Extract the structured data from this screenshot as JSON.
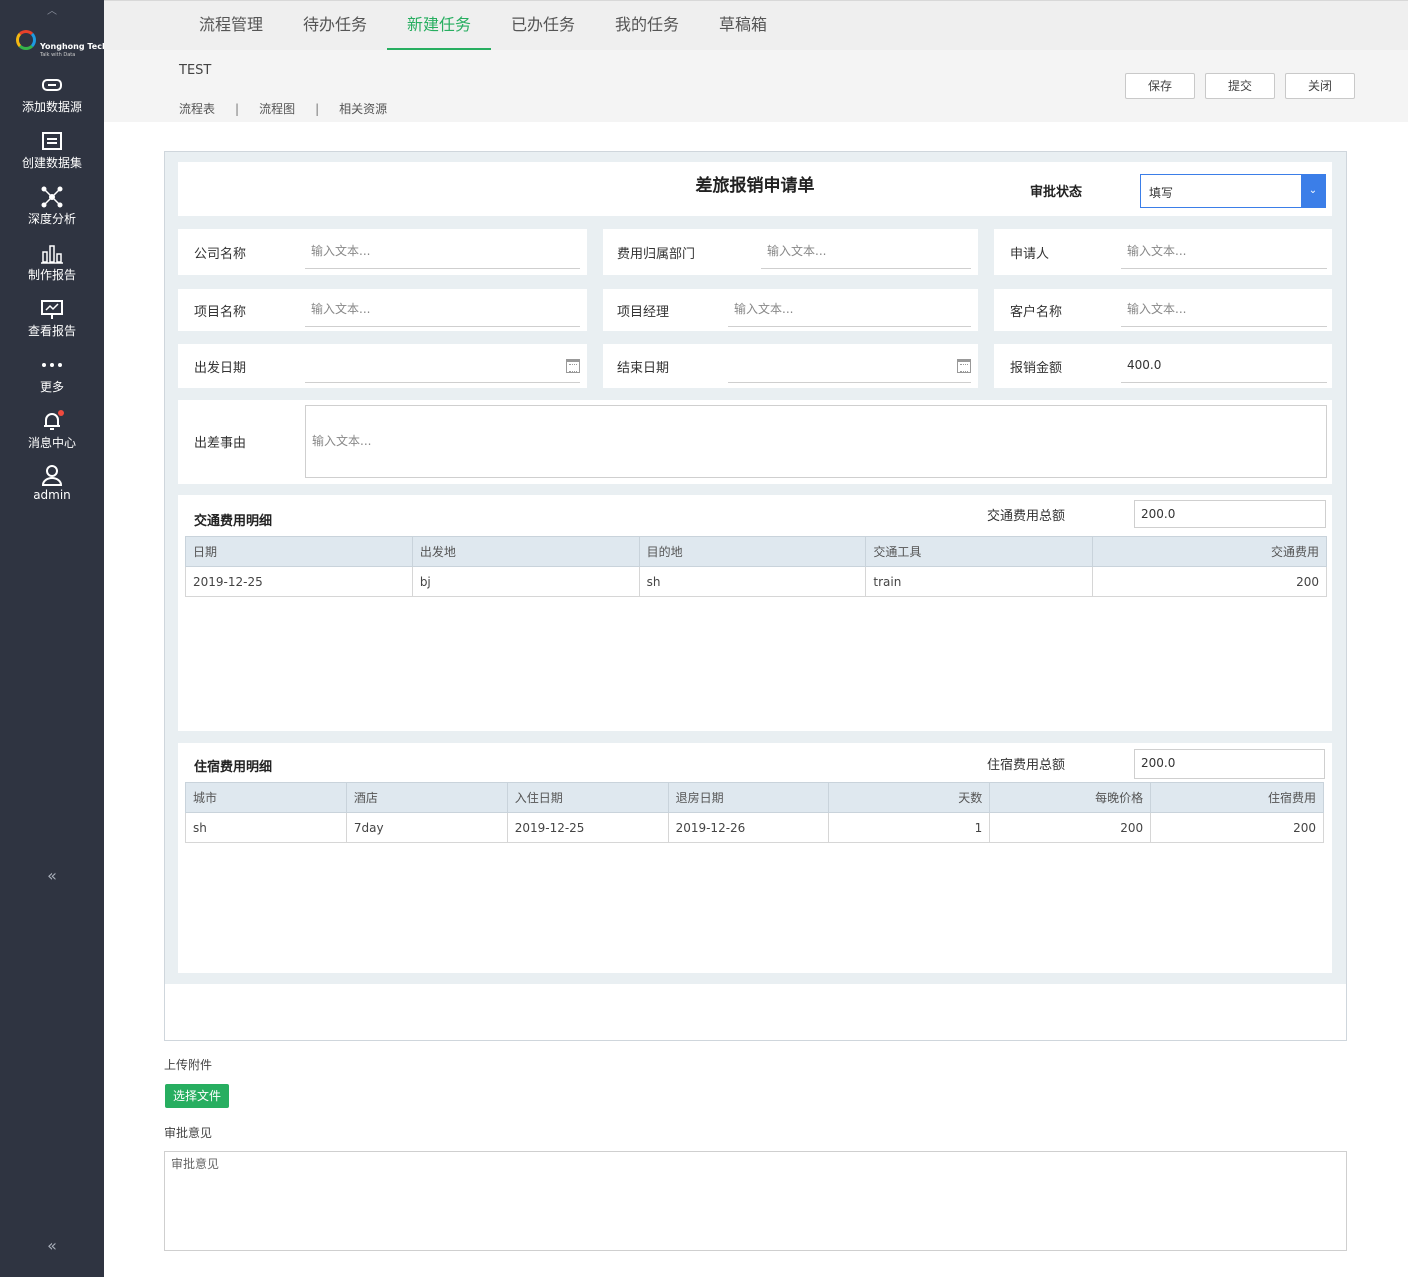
{
  "sidebar": {
    "logo": {
      "brand": "Yonghong Tech",
      "tagline": "Talk with Data"
    },
    "items": [
      {
        "label": "添加数据源",
        "icon": "link-icon"
      },
      {
        "label": "创建数据集",
        "icon": "dataset-icon"
      },
      {
        "label": "深度分析",
        "icon": "network-icon"
      },
      {
        "label": "制作报告",
        "icon": "bar-chart-icon"
      },
      {
        "label": "查看报告",
        "icon": "presentation-icon"
      },
      {
        "label": "更多",
        "icon": "more-icon"
      },
      {
        "label": "消息中心",
        "icon": "bell-icon"
      },
      {
        "label": "admin",
        "icon": "user-icon"
      }
    ],
    "collapse_glyph": "«"
  },
  "topnav": {
    "tabs": [
      "流程管理",
      "待办任务",
      "新建任务",
      "已办任务",
      "我的任务",
      "草稿箱"
    ],
    "active": "新建任务"
  },
  "header": {
    "title": "TEST",
    "links": [
      "流程表",
      "流程图",
      "相关资源"
    ],
    "separator": "|",
    "buttons": {
      "save": "保存",
      "submit": "提交",
      "close": "关闭"
    }
  },
  "form": {
    "title": "差旅报销申请单",
    "status_label": "审批状态",
    "status_value": "填写",
    "placeholder": "输入文本...",
    "fields": {
      "company": "公司名称",
      "department": "费用归属部门",
      "applicant": "申请人",
      "project": "项目名称",
      "manager": "项目经理",
      "customer": "客户名称",
      "start_date": "出发日期",
      "end_date": "结束日期",
      "amount": "报销金额",
      "amount_value": "400.0",
      "reason": "出差事由"
    },
    "transport": {
      "title": "交通费用明细",
      "total_label": "交通费用总额",
      "total_value": "200.0",
      "columns": [
        "日期",
        "出发地",
        "目的地",
        "交通工具",
        "交通费用"
      ],
      "rows": [
        [
          "2019-12-25",
          "bj",
          "sh",
          "train",
          "200"
        ]
      ]
    },
    "lodging": {
      "title": "住宿费用明细",
      "total_label": "住宿费用总额",
      "total_value": "200.0",
      "columns": [
        "城市",
        "酒店",
        "入住日期",
        "退房日期",
        "天数",
        "每晚价格",
        "住宿费用"
      ],
      "rows": [
        [
          "sh",
          "7day",
          "2019-12-25",
          "2019-12-26",
          "1",
          "200",
          "200"
        ]
      ]
    }
  },
  "attachment": {
    "label": "上传附件",
    "button": "选择文件"
  },
  "approval": {
    "label": "审批意见",
    "placeholder": "审批意见"
  }
}
